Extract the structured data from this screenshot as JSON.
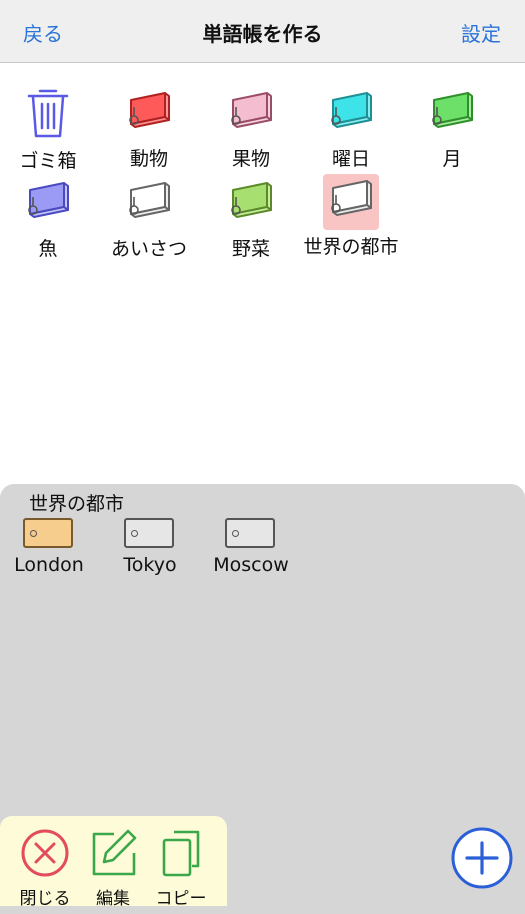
{
  "nav": {
    "back_label": "戻る",
    "title": "単語帳を作る",
    "settings_label": "設定"
  },
  "wordbooks": [
    {
      "label": "ゴミ箱",
      "icon": "trash-icon",
      "color": "#5a5ae6"
    },
    {
      "label": "動物",
      "icon": "wordbook-icon",
      "color": "#ff5a5a"
    },
    {
      "label": "果物",
      "icon": "wordbook-icon",
      "color": "#f5bdd0"
    },
    {
      "label": "曜日",
      "icon": "wordbook-icon",
      "color": "#3de3e8"
    },
    {
      "label": "月",
      "icon": "wordbook-icon",
      "color": "#6de06a"
    },
    {
      "label": "魚",
      "icon": "wordbook-icon",
      "color": "#9b9bf5"
    },
    {
      "label": "あいさつ",
      "icon": "wordbook-icon",
      "color": "#ffffff"
    },
    {
      "label": "野菜",
      "icon": "wordbook-icon",
      "color": "#a7e070"
    },
    {
      "label": "世界の都市",
      "icon": "wordbook-icon",
      "color": "#ffffff",
      "selected": true
    }
  ],
  "panel": {
    "title": "世界の都市",
    "cards": [
      {
        "label": "London",
        "active": true
      },
      {
        "label": "Tokyo",
        "active": false
      },
      {
        "label": "Moscow",
        "active": false
      }
    ]
  },
  "toolbar": {
    "close_label": "閉じる",
    "edit_label": "編集",
    "copy_label": "コピー"
  },
  "colors": {
    "accent": "#2a73d8",
    "close": "#e34b5e",
    "edit_copy": "#3aa84a",
    "toolbar_bg": "#fdfbd8",
    "panel_bg": "#d6d6d6"
  }
}
